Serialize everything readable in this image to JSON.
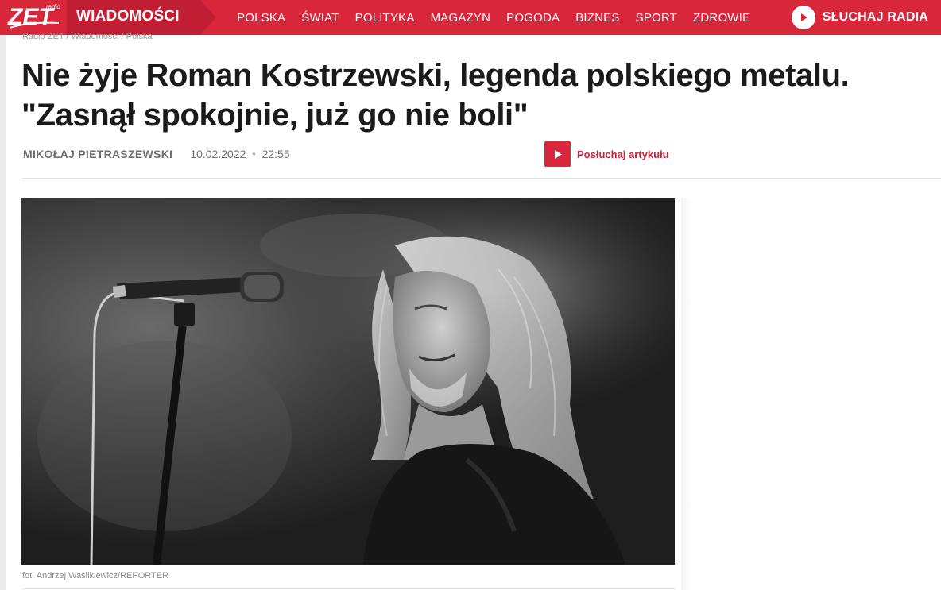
{
  "header": {
    "logo_text": "ZET",
    "logo_sub": "radio",
    "section": "WIADOMOŚCI",
    "nav": [
      "POLSKA",
      "ŚWIAT",
      "POLITYKA",
      "MAGAZYN",
      "POGODA",
      "BIZNES",
      "SPORT",
      "ZDROWIE"
    ],
    "listen_radio": "SŁUCHAJ RADIA"
  },
  "article": {
    "breadcrumb": "Radio ZET / Wiadomości / Polska",
    "title_line1": "Nie żyje Roman Kostrzewski, legenda polskiego metalu.",
    "title_line2": "\"Zasnął spokojnie, już go nie boli\"",
    "author": "MIKOŁAJ PIETRASZEWSKI",
    "date": "10.02.2022",
    "separator": "•",
    "time": "22:55",
    "listen_label": "Posłuchaj artykułu",
    "photo_caption": "fot. Andrzej Wasilkiewicz/REPORTER"
  },
  "colors": {
    "brand_red": "#d8263b",
    "headline": "#1b1b1b",
    "meta_gray": "#6d6d6d"
  },
  "icons": {
    "radio_play": "play-icon",
    "listen": "play-icon"
  }
}
